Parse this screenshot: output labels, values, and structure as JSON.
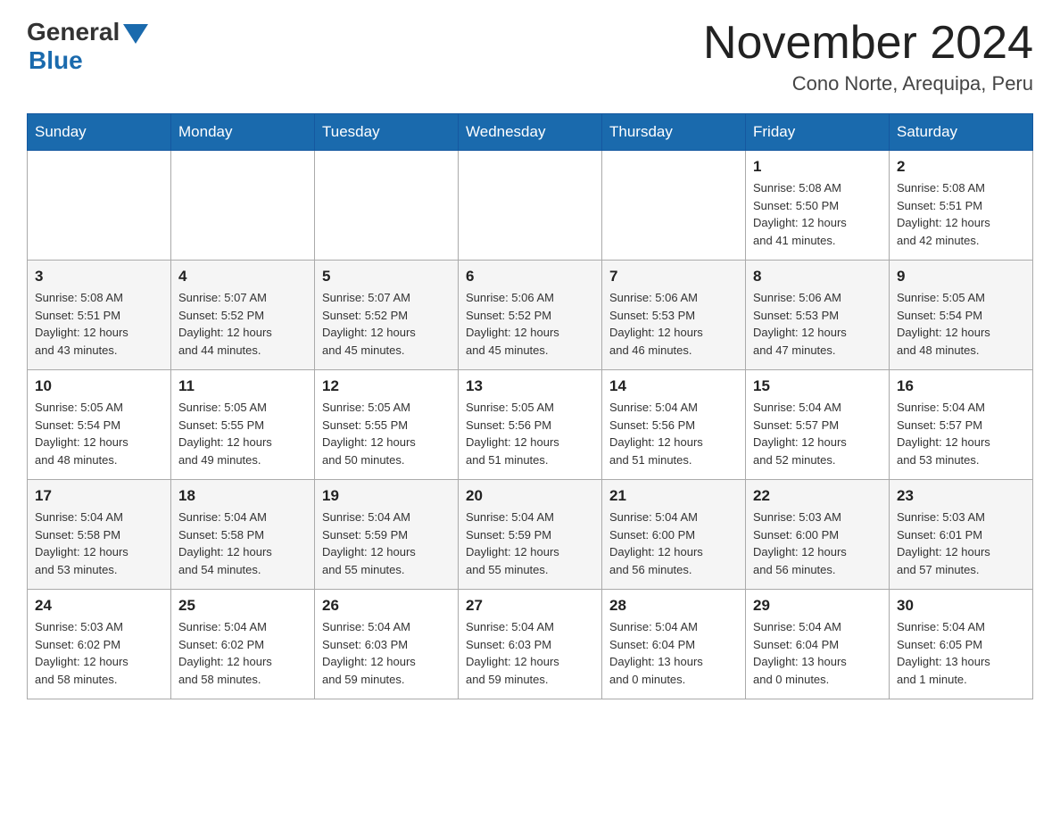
{
  "header": {
    "logo_general": "General",
    "logo_blue": "Blue",
    "month_year": "November 2024",
    "location": "Cono Norte, Arequipa, Peru"
  },
  "calendar": {
    "days_of_week": [
      "Sunday",
      "Monday",
      "Tuesday",
      "Wednesday",
      "Thursday",
      "Friday",
      "Saturday"
    ],
    "weeks": [
      [
        {
          "day": "",
          "info": ""
        },
        {
          "day": "",
          "info": ""
        },
        {
          "day": "",
          "info": ""
        },
        {
          "day": "",
          "info": ""
        },
        {
          "day": "",
          "info": ""
        },
        {
          "day": "1",
          "info": "Sunrise: 5:08 AM\nSunset: 5:50 PM\nDaylight: 12 hours\nand 41 minutes."
        },
        {
          "day": "2",
          "info": "Sunrise: 5:08 AM\nSunset: 5:51 PM\nDaylight: 12 hours\nand 42 minutes."
        }
      ],
      [
        {
          "day": "3",
          "info": "Sunrise: 5:08 AM\nSunset: 5:51 PM\nDaylight: 12 hours\nand 43 minutes."
        },
        {
          "day": "4",
          "info": "Sunrise: 5:07 AM\nSunset: 5:52 PM\nDaylight: 12 hours\nand 44 minutes."
        },
        {
          "day": "5",
          "info": "Sunrise: 5:07 AM\nSunset: 5:52 PM\nDaylight: 12 hours\nand 45 minutes."
        },
        {
          "day": "6",
          "info": "Sunrise: 5:06 AM\nSunset: 5:52 PM\nDaylight: 12 hours\nand 45 minutes."
        },
        {
          "day": "7",
          "info": "Sunrise: 5:06 AM\nSunset: 5:53 PM\nDaylight: 12 hours\nand 46 minutes."
        },
        {
          "day": "8",
          "info": "Sunrise: 5:06 AM\nSunset: 5:53 PM\nDaylight: 12 hours\nand 47 minutes."
        },
        {
          "day": "9",
          "info": "Sunrise: 5:05 AM\nSunset: 5:54 PM\nDaylight: 12 hours\nand 48 minutes."
        }
      ],
      [
        {
          "day": "10",
          "info": "Sunrise: 5:05 AM\nSunset: 5:54 PM\nDaylight: 12 hours\nand 48 minutes."
        },
        {
          "day": "11",
          "info": "Sunrise: 5:05 AM\nSunset: 5:55 PM\nDaylight: 12 hours\nand 49 minutes."
        },
        {
          "day": "12",
          "info": "Sunrise: 5:05 AM\nSunset: 5:55 PM\nDaylight: 12 hours\nand 50 minutes."
        },
        {
          "day": "13",
          "info": "Sunrise: 5:05 AM\nSunset: 5:56 PM\nDaylight: 12 hours\nand 51 minutes."
        },
        {
          "day": "14",
          "info": "Sunrise: 5:04 AM\nSunset: 5:56 PM\nDaylight: 12 hours\nand 51 minutes."
        },
        {
          "day": "15",
          "info": "Sunrise: 5:04 AM\nSunset: 5:57 PM\nDaylight: 12 hours\nand 52 minutes."
        },
        {
          "day": "16",
          "info": "Sunrise: 5:04 AM\nSunset: 5:57 PM\nDaylight: 12 hours\nand 53 minutes."
        }
      ],
      [
        {
          "day": "17",
          "info": "Sunrise: 5:04 AM\nSunset: 5:58 PM\nDaylight: 12 hours\nand 53 minutes."
        },
        {
          "day": "18",
          "info": "Sunrise: 5:04 AM\nSunset: 5:58 PM\nDaylight: 12 hours\nand 54 minutes."
        },
        {
          "day": "19",
          "info": "Sunrise: 5:04 AM\nSunset: 5:59 PM\nDaylight: 12 hours\nand 55 minutes."
        },
        {
          "day": "20",
          "info": "Sunrise: 5:04 AM\nSunset: 5:59 PM\nDaylight: 12 hours\nand 55 minutes."
        },
        {
          "day": "21",
          "info": "Sunrise: 5:04 AM\nSunset: 6:00 PM\nDaylight: 12 hours\nand 56 minutes."
        },
        {
          "day": "22",
          "info": "Sunrise: 5:03 AM\nSunset: 6:00 PM\nDaylight: 12 hours\nand 56 minutes."
        },
        {
          "day": "23",
          "info": "Sunrise: 5:03 AM\nSunset: 6:01 PM\nDaylight: 12 hours\nand 57 minutes."
        }
      ],
      [
        {
          "day": "24",
          "info": "Sunrise: 5:03 AM\nSunset: 6:02 PM\nDaylight: 12 hours\nand 58 minutes."
        },
        {
          "day": "25",
          "info": "Sunrise: 5:04 AM\nSunset: 6:02 PM\nDaylight: 12 hours\nand 58 minutes."
        },
        {
          "day": "26",
          "info": "Sunrise: 5:04 AM\nSunset: 6:03 PM\nDaylight: 12 hours\nand 59 minutes."
        },
        {
          "day": "27",
          "info": "Sunrise: 5:04 AM\nSunset: 6:03 PM\nDaylight: 12 hours\nand 59 minutes."
        },
        {
          "day": "28",
          "info": "Sunrise: 5:04 AM\nSunset: 6:04 PM\nDaylight: 13 hours\nand 0 minutes."
        },
        {
          "day": "29",
          "info": "Sunrise: 5:04 AM\nSunset: 6:04 PM\nDaylight: 13 hours\nand 0 minutes."
        },
        {
          "day": "30",
          "info": "Sunrise: 5:04 AM\nSunset: 6:05 PM\nDaylight: 13 hours\nand 1 minute."
        }
      ]
    ]
  }
}
